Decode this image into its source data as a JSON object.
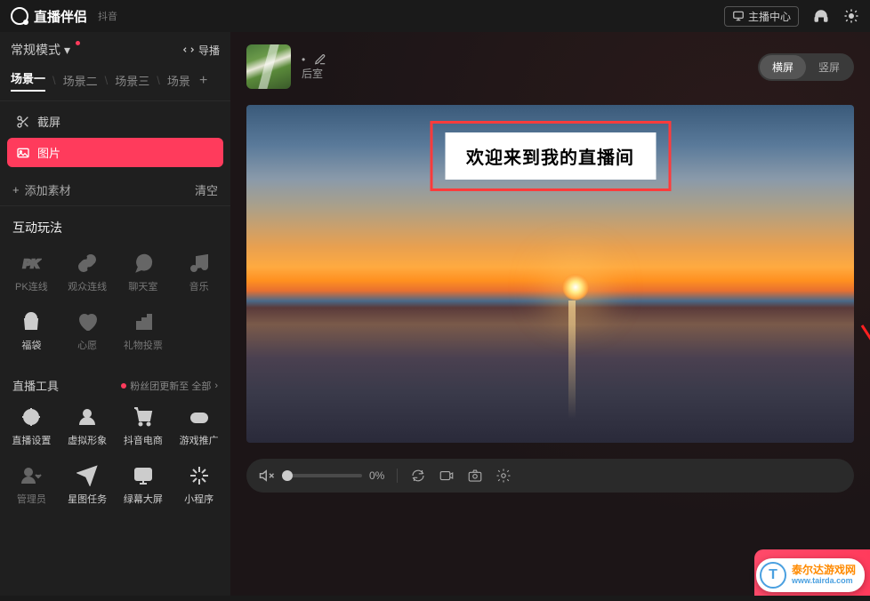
{
  "app": {
    "name": "直播伴侣",
    "platform": "抖音"
  },
  "topbar": {
    "anchor_center": "主播中心"
  },
  "sidebar": {
    "mode_label": "常规模式",
    "guide_label": "导播",
    "scenes": [
      "场景一",
      "场景二",
      "场景三",
      "场景"
    ],
    "sources": {
      "screenshot": "截屏",
      "image": "图片"
    },
    "add_material": "添加素材",
    "clear": "清空"
  },
  "interactive": {
    "title": "互动玩法",
    "items": [
      "PK连线",
      "观众连线",
      "聊天室",
      "音乐",
      "福袋",
      "心愿",
      "礼物投票"
    ]
  },
  "tools": {
    "title": "直播工具",
    "update_hint": "粉丝团更新至 全部",
    "items": [
      "直播设置",
      "虚拟形象",
      "抖音电商",
      "游戏推广",
      "管理员",
      "星图任务",
      "绿幕大屏",
      "小程序"
    ]
  },
  "canvas": {
    "backroom": "后室",
    "orient_landscape": "横屏",
    "orient_portrait": "竖屏",
    "overlay_text": "欢迎来到我的直播间"
  },
  "bottombar": {
    "volume_pct": "0%"
  },
  "watermark": {
    "badge": "T",
    "cn": "泰尔达游戏网",
    "url": "www.tairda.com"
  }
}
